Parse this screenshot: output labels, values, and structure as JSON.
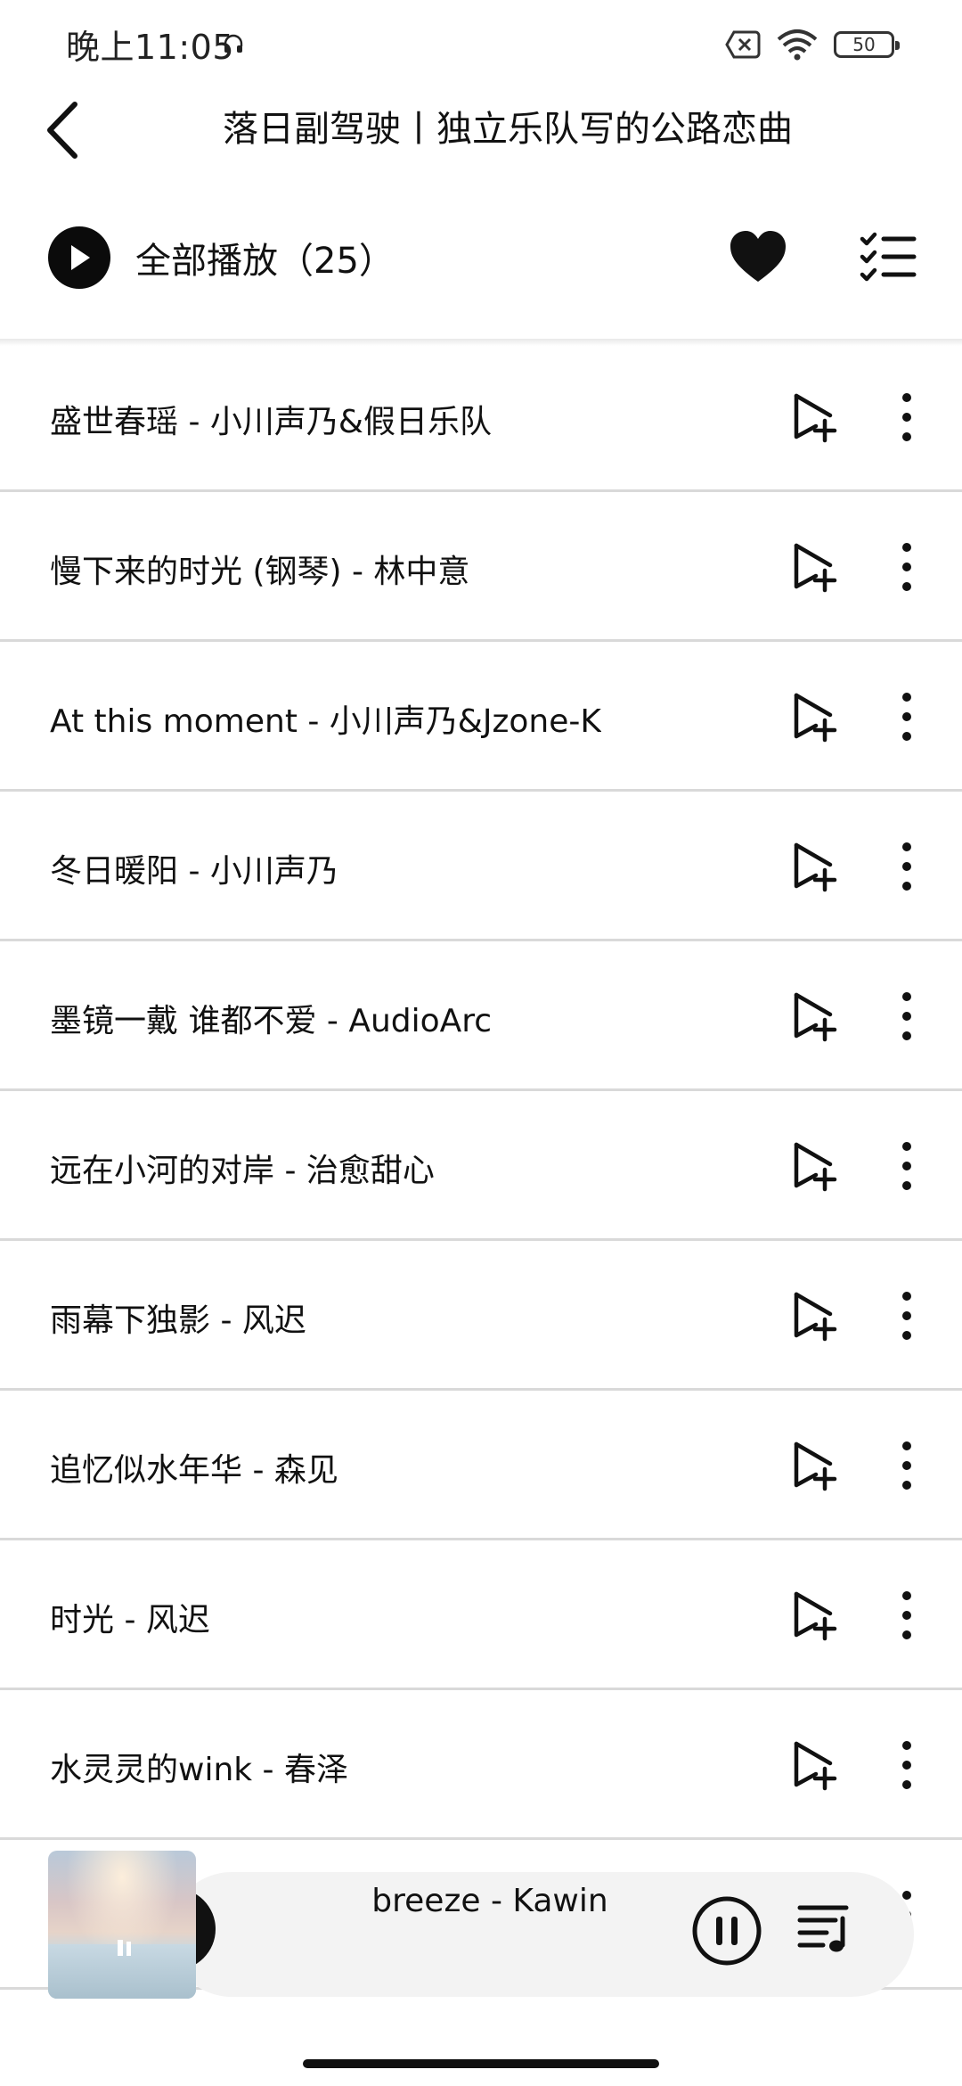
{
  "status_bar": {
    "time": "晚上11:05",
    "battery": "50"
  },
  "header": {
    "title": "落日副驾驶丨独立乐队写的公路恋曲"
  },
  "play_all": {
    "label": "全部播放（25）"
  },
  "songs": [
    {
      "text": "盛世春瑶 - 小川声乃&假日乐队"
    },
    {
      "text": "慢下来的时光 (钢琴) - 林中意"
    },
    {
      "text": "At this moment - 小川声乃&Jzone-K"
    },
    {
      "text": "冬日暖阳 - 小川声乃"
    },
    {
      "text": "墨镜一戴 谁都不爱 - AudioArc"
    },
    {
      "text": "远在小河的对岸 - 治愈甜心"
    },
    {
      "text": "雨幕下独影 - 风迟"
    },
    {
      "text": "追忆似水年华 - 森见"
    },
    {
      "text": "时光 - 风迟"
    },
    {
      "text": "水灵灵的wink - 春泽"
    },
    {
      "text": ""
    }
  ],
  "mini_player": {
    "now_playing": "breeze - Kawin"
  },
  "colors": {
    "accent": "#0b0b0b",
    "divider": "#d9d9d9",
    "player_bg": "#f3f3f3"
  },
  "icons": [
    "back-arrow-icon",
    "play-icon",
    "heart-icon",
    "multi-select-list-icon",
    "add-to-playlist-icon",
    "more-vertical-icon",
    "pause-icon",
    "playlist-queue-icon",
    "wifi-icon",
    "sim-off-icon",
    "headset-icon",
    "battery-icon"
  ]
}
